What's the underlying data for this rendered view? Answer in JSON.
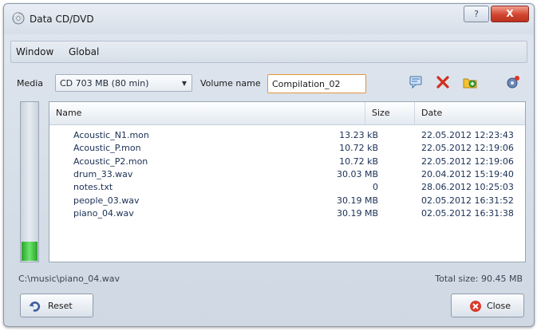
{
  "window": {
    "title": "Data CD/DVD",
    "help_label": "?",
    "close_label": "X"
  },
  "menu": {
    "items": [
      "Window",
      "Global"
    ]
  },
  "media": {
    "label": "Media",
    "selected": "CD 703 MB (80 min)"
  },
  "volume": {
    "label": "Volume name",
    "value": "Compilation_02"
  },
  "toolbar": {
    "icons": [
      "comment-icon",
      "delete-icon",
      "add-folder-icon",
      "settings-icon"
    ]
  },
  "meter": {
    "fill_fraction": 0.12,
    "color": "#35c035"
  },
  "list": {
    "columns": {
      "name": "Name",
      "size": "Size",
      "date": "Date"
    },
    "rows": [
      {
        "name": "Acoustic_N1.mon",
        "size": "13.23 kB",
        "date": "22.05.2012 12:23:43"
      },
      {
        "name": "Acoustic_P.mon",
        "size": "10.72 kB",
        "date": "22.05.2012 12:19:06"
      },
      {
        "name": "Acoustic_P2.mon",
        "size": "10.72 kB",
        "date": "22.05.2012 12:19:06"
      },
      {
        "name": "drum_33.wav",
        "size": "30.03 MB",
        "date": "20.04.2012 15:19:40"
      },
      {
        "name": "notes.txt",
        "size": "0",
        "date": "28.06.2012 10:25:03"
      },
      {
        "name": "people_03.wav",
        "size": "30.19 MB",
        "date": "02.05.2012 16:31:52"
      },
      {
        "name": "piano_04.wav",
        "size": "30.19 MB",
        "date": "02.05.2012 16:31:38"
      }
    ]
  },
  "status": {
    "path": "C:\\music\\piano_04.wav",
    "total": "Total size: 90.45 MB"
  },
  "buttons": {
    "reset": "Reset",
    "close": "Close"
  },
  "colors": {
    "accent": "#e8953b",
    "close_red": "#d2452f",
    "link_text": "#1a2f55"
  }
}
